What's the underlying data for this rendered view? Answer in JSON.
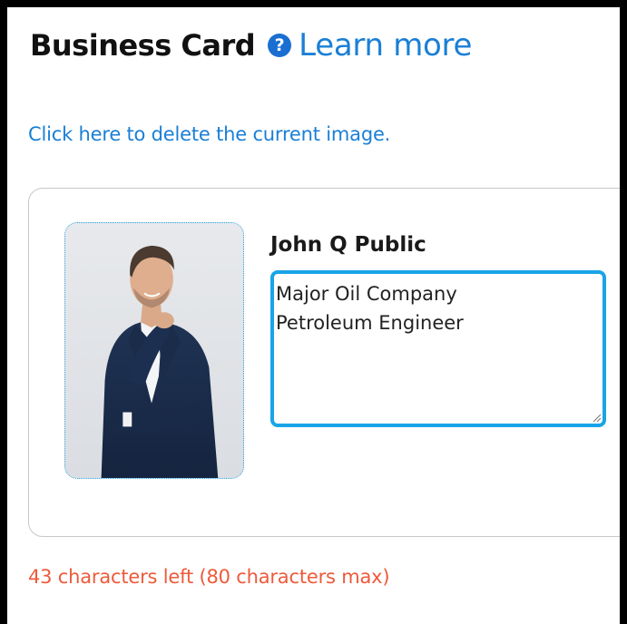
{
  "header": {
    "title": "Business Card",
    "help_icon_glyph": "?",
    "learn_more": "Learn more"
  },
  "delete_image_link": "Click here to delete the current image.",
  "card": {
    "photo_alt": "John Q Public",
    "name": "John Q Public",
    "description": "Major Oil Company\nPetroleum Engineer"
  },
  "counter_text": "43 characters left (80 characters max)",
  "colors": {
    "link": "#1a7fd6",
    "help_icon": "#1a6fd1",
    "textarea_focus": "#19a4e8",
    "counter": "#ee5a3a"
  },
  "icons": {
    "help": "question-circle-icon",
    "resize": "resize-grip-icon"
  }
}
